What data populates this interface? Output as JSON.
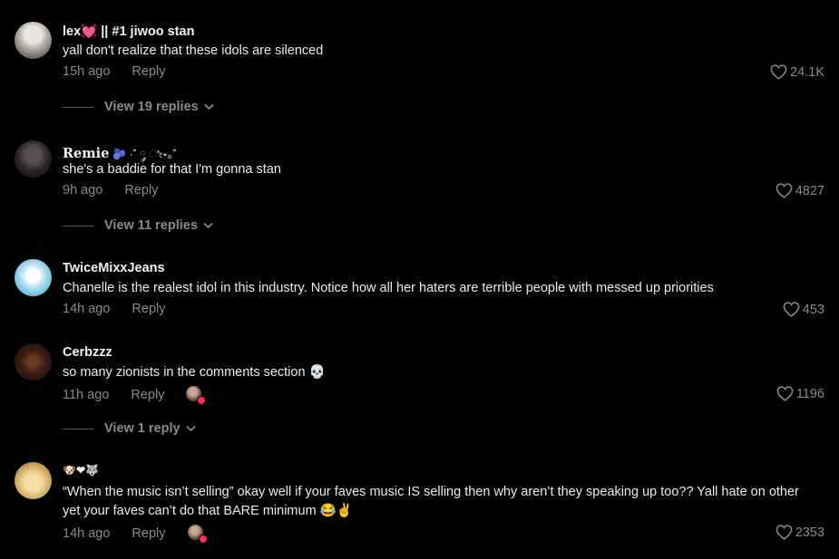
{
  "comments": [
    {
      "username": "lex💓 || #1 jiwoo stan",
      "text": "yall don't realize that these idols are silenced",
      "time": "15h ago",
      "reply_label": "Reply",
      "likes": "24.1K",
      "view_replies": "View 19 replies"
    },
    {
      "username": "Remie",
      "username_deco": "🫐 ·˚ ༘ ೀ⋆｡˚",
      "text": "she's a baddie for that I'm gonna stan",
      "time": "9h ago",
      "reply_label": "Reply",
      "likes": "4827",
      "view_replies": "View 11 replies"
    },
    {
      "username": "TwiceMixxJeans",
      "text": "Chanelle is the realest idol in this industry. Notice how all her haters are terrible people with messed up priorities",
      "time": "14h ago",
      "reply_label": "Reply",
      "likes": "453"
    },
    {
      "username": "Cerbzzz",
      "text": "so many zionists in the comments section 💀",
      "time": "11h ago",
      "reply_label": "Reply",
      "likes": "1196",
      "view_replies": "View 1 reply"
    },
    {
      "username": "🐶❤🐺",
      "text": "“When the music isn’t selling” okay well if your faves music IS selling then why aren’t they speaking up too?? Yall hate on other yet your faves can’t do that BARE minimum 😂✌",
      "time": "14h ago",
      "reply_label": "Reply",
      "likes": "2353"
    }
  ],
  "colors": {
    "background": "#000000",
    "meta_text": "#8a8a8a",
    "like_badge": "#fe2c55"
  }
}
